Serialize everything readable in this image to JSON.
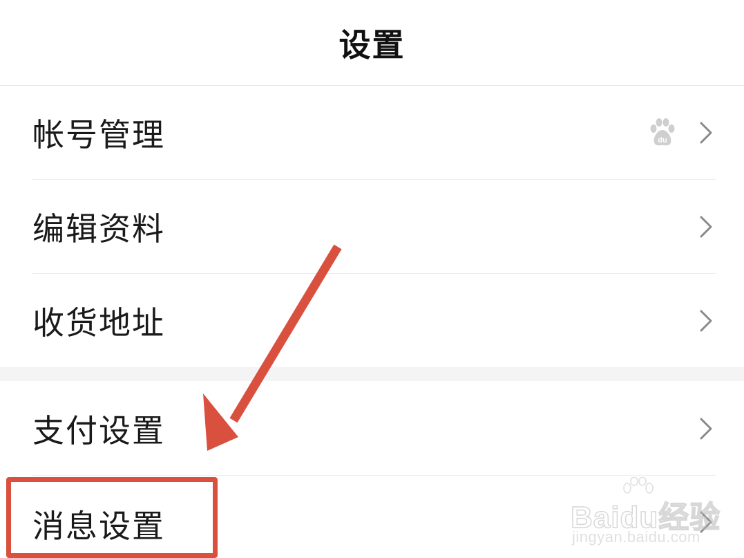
{
  "header": {
    "title": "设置"
  },
  "settings": {
    "items": [
      {
        "label": "帐号管理",
        "badge_icon": "baidu-paw-icon"
      },
      {
        "label": "编辑资料"
      },
      {
        "label": "收货地址"
      },
      {
        "label": "支付设置"
      },
      {
        "label": "消息设置"
      }
    ]
  },
  "annotation": {
    "highlight_color": "#d9503f",
    "arrow_color": "#d9503f",
    "target": "消息设置"
  },
  "watermark": {
    "brand": "Baidu经验",
    "url": "jingyan.baidu.com"
  },
  "colors": {
    "chevron": "#8a8a8a",
    "paw": "#cfcfcf",
    "divider": "#ececec"
  }
}
